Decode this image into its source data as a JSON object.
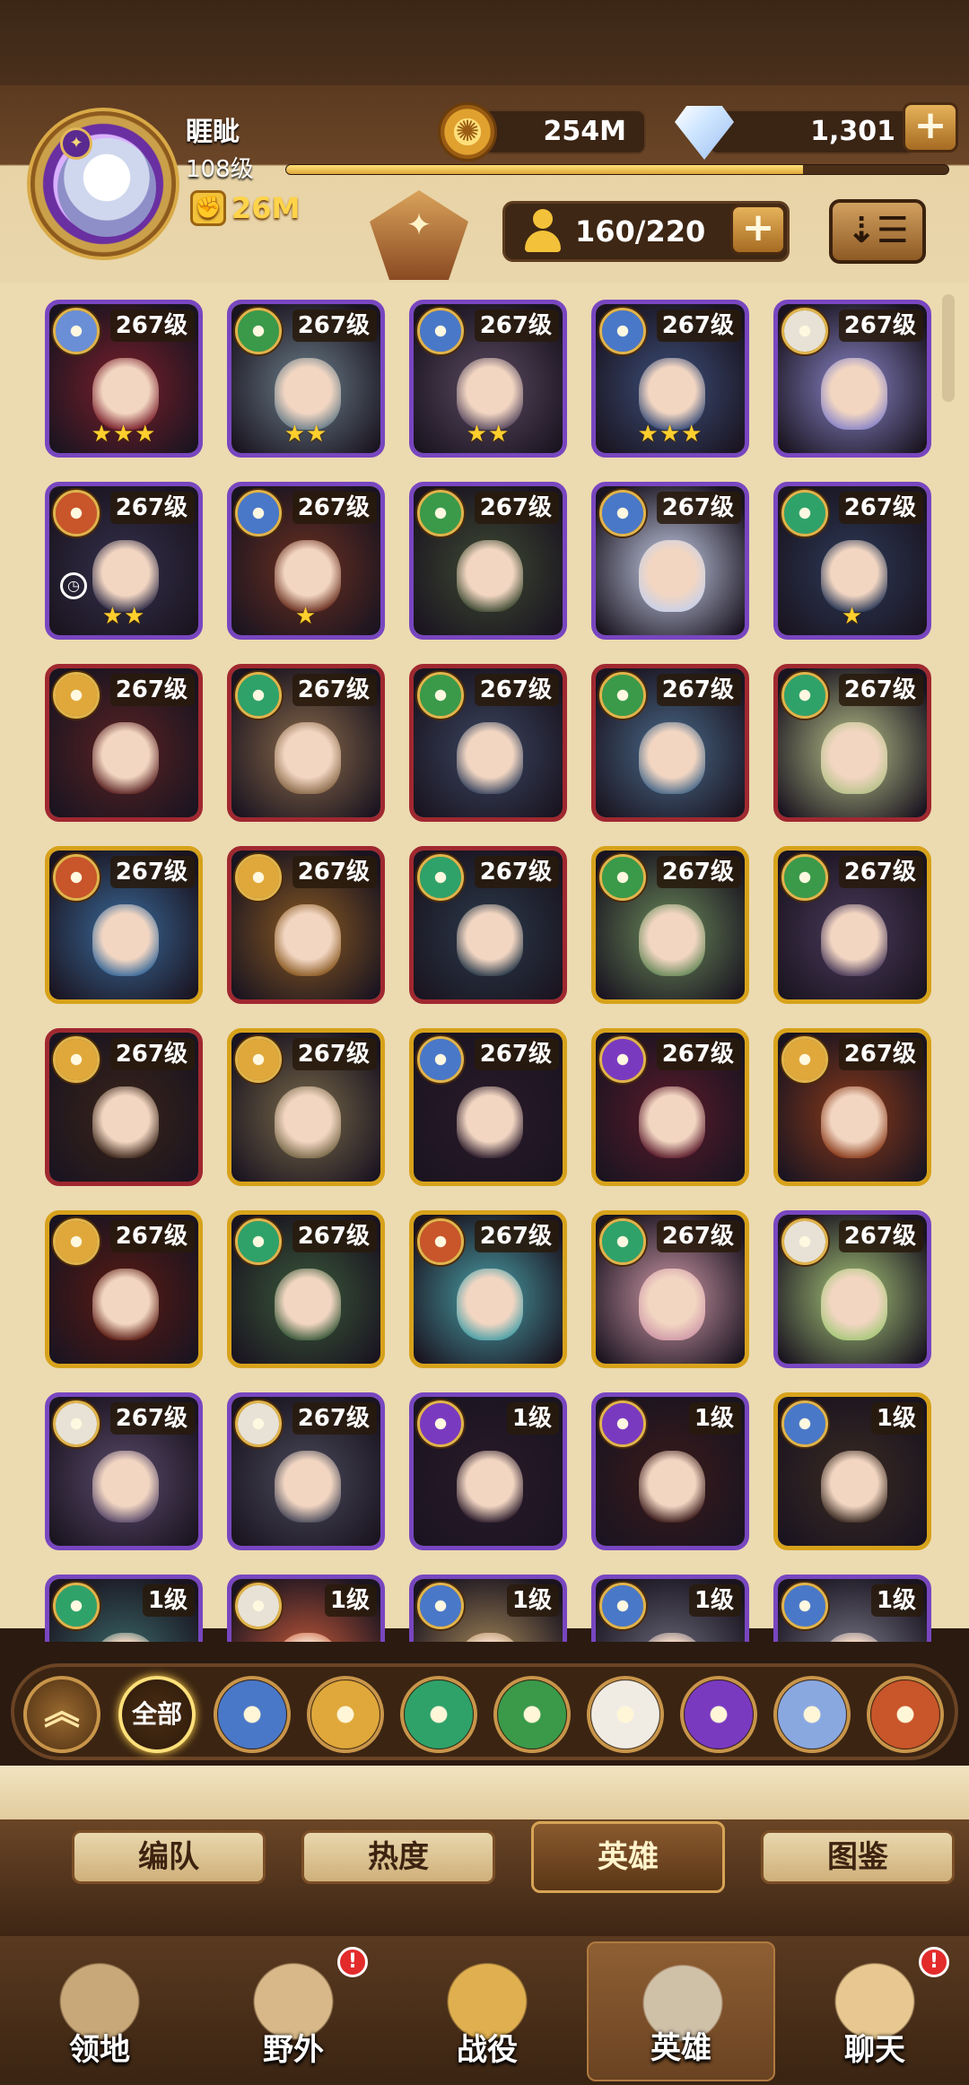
{
  "player": {
    "name": "睚眦",
    "level": "108级",
    "power": "26M",
    "xp_fraction": 0.78
  },
  "resources": {
    "gold": "254M",
    "diamonds": "1,301"
  },
  "roster": {
    "capacity": "160/220"
  },
  "icons": {
    "plus": "plus-icon",
    "sort": "sort-icon",
    "gold": "gold-coin-icon",
    "diamond": "diamond-icon",
    "fist": "fist-icon"
  },
  "heroes": [
    {
      "level": "267级",
      "stars": "★★★",
      "frame": "purple",
      "faction": "#6a8fd6",
      "art": "#7a1f2a"
    },
    {
      "level": "267级",
      "stars": "★★",
      "frame": "purple",
      "faction": "#3a9a4a",
      "art": "#6b7f8a"
    },
    {
      "level": "267级",
      "stars": "★★",
      "frame": "purple",
      "faction": "#4a78c8",
      "art": "#5a4a60"
    },
    {
      "level": "267级",
      "stars": "★★★",
      "frame": "purple",
      "faction": "#4a78c8",
      "art": "#3c4f7a"
    },
    {
      "level": "267级",
      "stars": "",
      "frame": "purple",
      "faction": "#e8e2d6",
      "art": "#8a86c8"
    },
    {
      "level": "267级",
      "stars": "★★",
      "frame": "purple",
      "faction": "#c9552a",
      "art": "#34304a",
      "clock": true
    },
    {
      "level": "267级",
      "stars": "★",
      "frame": "purple",
      "faction": "#4a78c8",
      "art": "#6b3020"
    },
    {
      "level": "267级",
      "stars": "",
      "frame": "purple",
      "faction": "#3a9a4a",
      "art": "#3e4a32"
    },
    {
      "level": "267级",
      "stars": "",
      "frame": "purple",
      "faction": "#4a78c8",
      "art": "#c8d0e8"
    },
    {
      "level": "267级",
      "stars": "★",
      "frame": "purple",
      "faction": "#2fa26a",
      "art": "#2c3a58"
    },
    {
      "level": "267级",
      "stars": "",
      "frame": "red",
      "faction": "#e0a83a",
      "art": "#5a2222"
    },
    {
      "level": "267级",
      "stars": "",
      "frame": "red",
      "faction": "#2fa26a",
      "art": "#8a6a4a"
    },
    {
      "level": "267级",
      "stars": "",
      "frame": "red",
      "faction": "#3a9a4a",
      "art": "#3a4660"
    },
    {
      "level": "267级",
      "stars": "",
      "frame": "red",
      "faction": "#3a9a4a",
      "art": "#4a6a8a"
    },
    {
      "level": "267级",
      "stars": "",
      "frame": "red",
      "faction": "#2fa26a",
      "art": "#b8c28a"
    },
    {
      "level": "267级",
      "stars": "",
      "frame": "gold",
      "faction": "#c9552a",
      "art": "#3a6a9a"
    },
    {
      "level": "267级",
      "stars": "",
      "frame": "red",
      "faction": "#e0a83a",
      "art": "#8a5a22"
    },
    {
      "level": "267级",
      "stars": "",
      "frame": "red",
      "faction": "#2fa26a",
      "art": "#2a3a4a"
    },
    {
      "level": "267级",
      "stars": "",
      "frame": "gold",
      "faction": "#3a9a4a",
      "art": "#6a8a5a"
    },
    {
      "level": "267级",
      "stars": "",
      "frame": "gold",
      "faction": "#3a9a4a",
      "art": "#4a3a5a"
    },
    {
      "level": "267级",
      "stars": "",
      "frame": "red",
      "faction": "#e0a83a",
      "art": "#3a2418"
    },
    {
      "level": "267级",
      "stars": "",
      "frame": "gold",
      "faction": "#e0a83a",
      "art": "#7a6a4a"
    },
    {
      "level": "267级",
      "stars": "",
      "frame": "gold",
      "faction": "#4a78c8",
      "art": "#2a1a2a"
    },
    {
      "level": "267级",
      "stars": "",
      "frame": "gold",
      "faction": "#7a3ac0",
      "art": "#5a1a2a"
    },
    {
      "level": "267级",
      "stars": "",
      "frame": "gold",
      "faction": "#e0a83a",
      "art": "#8a3a1a"
    },
    {
      "level": "267级",
      "stars": "",
      "frame": "gold",
      "faction": "#e0a83a",
      "art": "#5a1a12"
    },
    {
      "level": "267级",
      "stars": "",
      "frame": "gold",
      "faction": "#2fa26a",
      "art": "#3a5a3a"
    },
    {
      "level": "267级",
      "stars": "",
      "frame": "gold",
      "faction": "#c9552a",
      "art": "#4aa0a8"
    },
    {
      "level": "267级",
      "stars": "",
      "frame": "gold",
      "faction": "#2fa26a",
      "art": "#d09aa8"
    },
    {
      "level": "267级",
      "stars": "",
      "frame": "purple",
      "faction": "#e8e2d6",
      "art": "#a8c87a"
    },
    {
      "level": "267级",
      "stars": "",
      "frame": "purple",
      "faction": "#e8e2d6",
      "art": "#5a4a6a"
    },
    {
      "level": "267级",
      "stars": "",
      "frame": "purple",
      "faction": "#e8e2d6",
      "art": "#4a4a5a"
    },
    {
      "level": "1级",
      "stars": "",
      "frame": "purple",
      "faction": "#7a3ac0",
      "art": "#2a1a2a"
    },
    {
      "level": "1级",
      "stars": "",
      "frame": "purple",
      "faction": "#7a3ac0",
      "art": "#3a1a1a"
    },
    {
      "level": "1级",
      "stars": "",
      "frame": "gold",
      "faction": "#4a78c8",
      "art": "#3a2a22"
    },
    {
      "level": "1级",
      "stars": "",
      "frame": "purple",
      "faction": "#2fa26a",
      "art": "#3a6a6a"
    },
    {
      "level": "1级",
      "stars": "",
      "frame": "purple",
      "faction": "#e8e2d6",
      "art": "#c85a3a"
    },
    {
      "level": "1级",
      "stars": "",
      "frame": "purple",
      "faction": "#4a78c8",
      "art": "#a88a5a"
    },
    {
      "level": "1级",
      "stars": "",
      "frame": "purple",
      "faction": "#4a78c8",
      "art": "#6a6a7a"
    },
    {
      "level": "1级",
      "stars": "",
      "frame": "purple",
      "faction": "#4a78c8",
      "art": "#7a7a8a"
    }
  ],
  "filters": {
    "all_label": "全部",
    "items": [
      {
        "name": "lightbearer-filter-icon",
        "color": "#4a78c8"
      },
      {
        "name": "mauler-filter-icon",
        "color": "#e0a83a"
      },
      {
        "name": "wilder-filter-icon",
        "color": "#2fa26a"
      },
      {
        "name": "graveborn-filter-icon",
        "color": "#3a9a4a"
      },
      {
        "name": "celestial-filter-icon",
        "color": "#f0ece4"
      },
      {
        "name": "hypogean-filter-icon",
        "color": "#7a3ac0"
      },
      {
        "name": "dimensional-filter-icon",
        "color": "#8aa8e0"
      },
      {
        "name": "lightbearer-alt-filter-icon",
        "color": "#c9552a"
      }
    ]
  },
  "tabs": [
    {
      "label": "编队",
      "active": false
    },
    {
      "label": "热度",
      "active": false
    },
    {
      "label": "英雄",
      "active": true
    },
    {
      "label": "图鉴",
      "active": false
    }
  ],
  "nav": [
    {
      "label": "领地",
      "icon": "castle-icon",
      "badge": "",
      "active": false
    },
    {
      "label": "野外",
      "icon": "map-scroll-icon",
      "badge": "!",
      "active": false
    },
    {
      "label": "战役",
      "icon": "sword-icon",
      "badge": "",
      "active": false
    },
    {
      "label": "英雄",
      "icon": "helmet-icon",
      "badge": "",
      "active": true
    },
    {
      "label": "聊天",
      "icon": "chat-bubble-icon",
      "badge": "!",
      "active": false
    }
  ]
}
